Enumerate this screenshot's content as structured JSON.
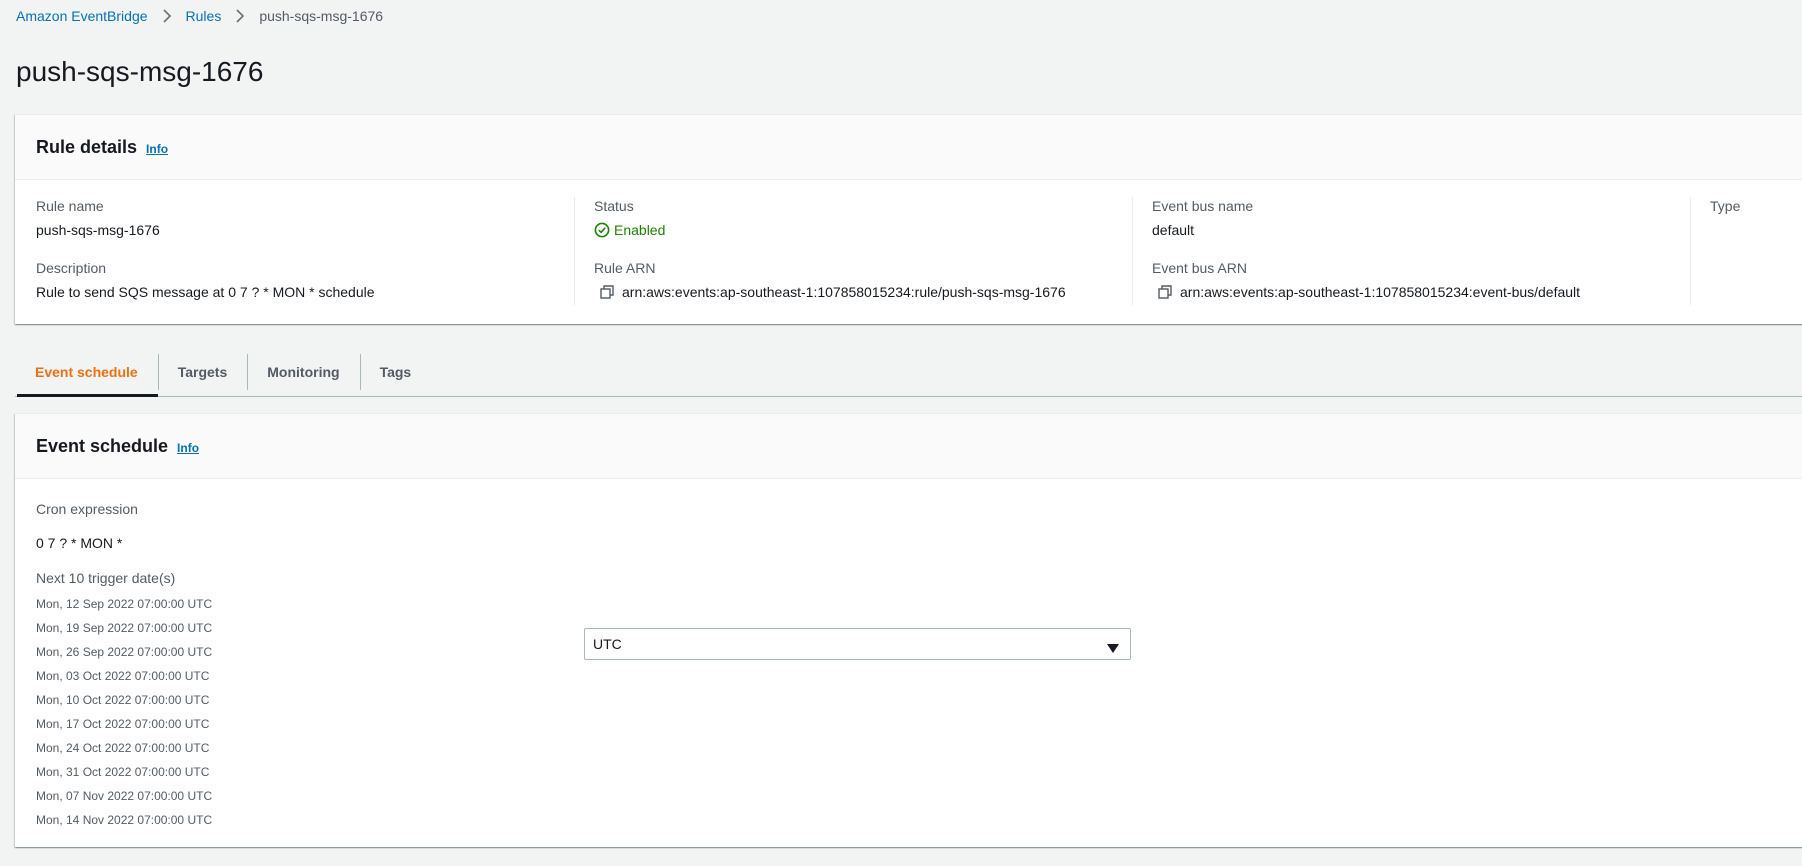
{
  "breadcrumb": {
    "items": [
      "Amazon EventBridge",
      "Rules"
    ],
    "current": "push-sqs-msg-1676"
  },
  "page_title": "push-sqs-msg-1676",
  "rule_details": {
    "title": "Rule details",
    "info_label": "Info",
    "rule_name_label": "Rule name",
    "rule_name": "push-sqs-msg-1676",
    "description_label": "Description",
    "description": "Rule to send SQS message at 0 7 ? * MON * schedule",
    "status_label": "Status",
    "status": "Enabled",
    "status_color": "#1d8102",
    "rule_arn_label": "Rule ARN",
    "rule_arn": "arn:aws:events:ap-southeast-1:107858015234:rule/push-sqs-msg-1676",
    "event_bus_name_label": "Event bus name",
    "event_bus_name": "default",
    "event_bus_arn_label": "Event bus ARN",
    "event_bus_arn": "arn:aws:events:ap-southeast-1:107858015234:event-bus/default",
    "type_label": "Type"
  },
  "tabs": [
    {
      "label": "Event schedule",
      "active": true
    },
    {
      "label": "Targets",
      "active": false
    },
    {
      "label": "Monitoring",
      "active": false
    },
    {
      "label": "Tags",
      "active": false
    }
  ],
  "event_schedule": {
    "title": "Event schedule",
    "info_label": "Info",
    "cron_label": "Cron expression",
    "cron_value": "0 7 ? * MON *",
    "next_label": "Next 10 trigger date(s)",
    "timezone": "UTC",
    "dates": [
      "Mon, 12 Sep 2022 07:00:00 UTC",
      "Mon, 19 Sep 2022 07:00:00 UTC",
      "Mon, 26 Sep 2022 07:00:00 UTC",
      "Mon, 03 Oct 2022 07:00:00 UTC",
      "Mon, 10 Oct 2022 07:00:00 UTC",
      "Mon, 17 Oct 2022 07:00:00 UTC",
      "Mon, 24 Oct 2022 07:00:00 UTC",
      "Mon, 31 Oct 2022 07:00:00 UTC",
      "Mon, 07 Nov 2022 07:00:00 UTC",
      "Mon, 14 Nov 2022 07:00:00 UTC"
    ]
  },
  "colors": {
    "link": "#0073bb",
    "active_tab": "#ec7211",
    "background": "#f2f3f3"
  },
  "icons": [
    "chevron-right-icon",
    "check-circle-icon",
    "copy-icon",
    "caret-down-icon"
  ]
}
